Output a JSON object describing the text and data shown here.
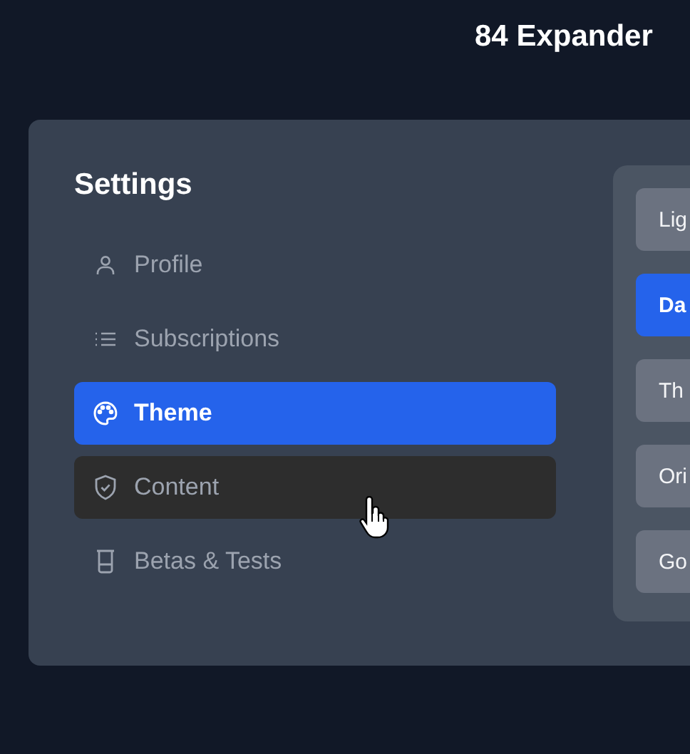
{
  "page": {
    "title": "84 Expander"
  },
  "settings": {
    "heading": "Settings",
    "items": [
      {
        "label": "Profile",
        "selected": false,
        "hovered": false
      },
      {
        "label": "Subscriptions",
        "selected": false,
        "hovered": false
      },
      {
        "label": "Theme",
        "selected": true,
        "hovered": false
      },
      {
        "label": "Content",
        "selected": false,
        "hovered": true
      },
      {
        "label": "Betas & Tests",
        "selected": false,
        "hovered": false
      }
    ]
  },
  "theme_options": [
    {
      "label": "Lig",
      "selected": false
    },
    {
      "label": "Da",
      "selected": true
    },
    {
      "label": "Th",
      "selected": false
    },
    {
      "label": "Ori",
      "selected": false
    },
    {
      "label": "Go",
      "selected": false
    }
  ]
}
